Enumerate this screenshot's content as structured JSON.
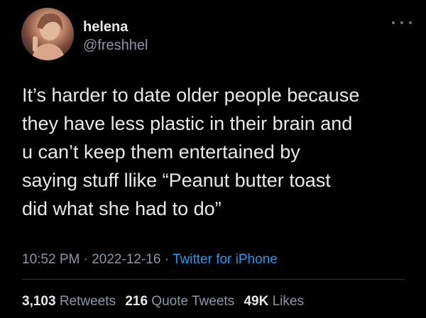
{
  "author": {
    "display_name": "helena",
    "handle": "@freshhel",
    "avatar_icon": "profile-photo"
  },
  "tweet": {
    "text": "It’s harder to date older people because\nthey have less plastic in their brain and\nu can’t keep them entertained by\nsaying stuff llike “Peanut butter toast\ndid what she had to do”"
  },
  "meta": {
    "time": "10:52 PM",
    "separator": " · ",
    "date": "2022-12-16",
    "source": "Twitter for iPhone"
  },
  "stats": {
    "retweets_count": "3,103",
    "retweets_label": "Retweets",
    "quotes_count": "216",
    "quotes_label": "Quote Tweets",
    "likes_count": "49K",
    "likes_label": "Likes"
  },
  "colors": {
    "background": "#000000",
    "text": "#e7e9ea",
    "secondary": "#8b98a5",
    "link": "#1d9bf0"
  }
}
